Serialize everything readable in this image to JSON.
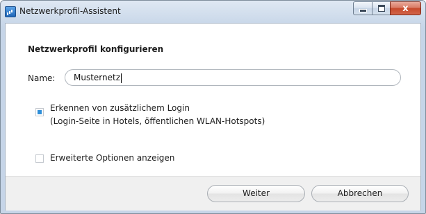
{
  "window": {
    "title": "Netzwerkprofil-Assistent",
    "icon": "network-signal-icon",
    "caption": {
      "close_symbol": "x"
    }
  },
  "main": {
    "heading": "Netzwerkprofil konfigurieren",
    "name_label": "Name:",
    "name_value": "Musternetz",
    "login_option": {
      "checked": true,
      "line1": "Erkennen von zusätzlichem Login",
      "line2": "(Login-Seite in Hotels, öffentlichen WLAN-Hotspots)"
    },
    "advanced_option": {
      "checked": false,
      "label": "Erweiterte Optionen anzeigen"
    }
  },
  "footer": {
    "next_label": "Weiter",
    "cancel_label": "Abbrechen"
  },
  "colors": {
    "titlebar": "#cbd9ea",
    "checkbox_fill": "#2f8fd8",
    "close_button": "#c6482a"
  }
}
